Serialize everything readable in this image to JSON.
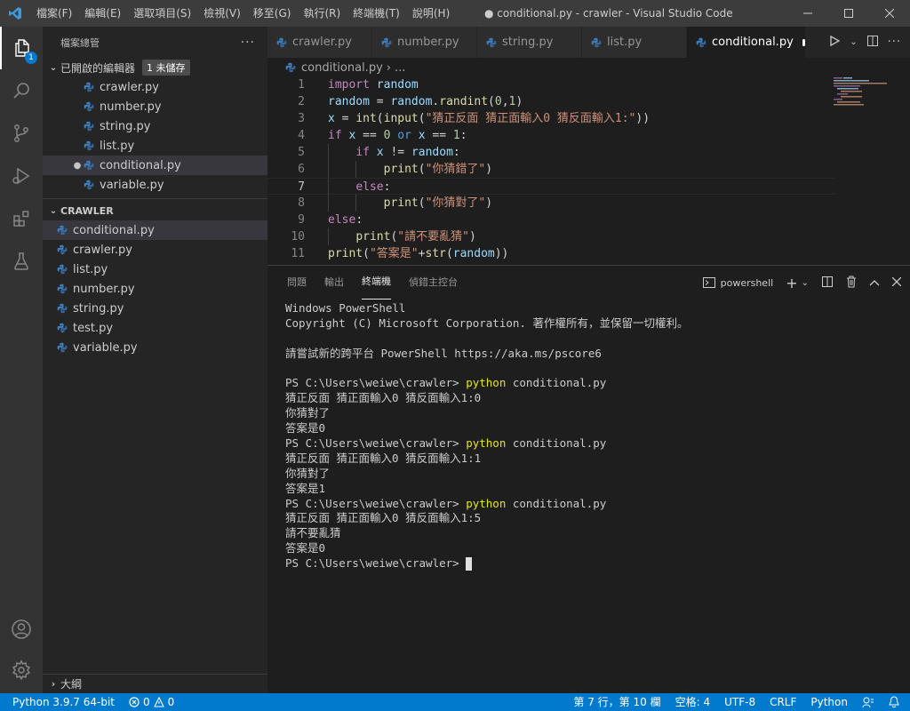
{
  "window": {
    "menu": [
      "檔案(F)",
      "編輯(E)",
      "選取項目(S)",
      "檢視(V)",
      "移至(G)",
      "執行(R)",
      "終端機(T)",
      "說明(H)"
    ],
    "title": "● conditional.py - crawler - Visual Studio Code"
  },
  "activitybar": {
    "explorer_badge": "1"
  },
  "sidebar": {
    "header": "檔案總管",
    "open_editors": {
      "title": "已開啟的編輯器",
      "unsaved_badge": "1 未儲存",
      "files": [
        "crawler.py",
        "number.py",
        "string.py",
        "list.py",
        "conditional.py",
        "variable.py"
      ]
    },
    "folder": {
      "title": "CRAWLER",
      "files": [
        "conditional.py",
        "crawler.py",
        "list.py",
        "number.py",
        "string.py",
        "test.py",
        "variable.py"
      ]
    },
    "outline": "大綱"
  },
  "tabs": [
    "crawler.py",
    "number.py",
    "string.py",
    "list.py",
    "conditional.py"
  ],
  "breadcrumb": {
    "file": "conditional.py",
    "rest": "..."
  },
  "editor": {
    "lines": [
      "1",
      "2",
      "3",
      "4",
      "5",
      "6",
      "7",
      "8",
      "9",
      "10",
      "11"
    ],
    "current_line": 7
  },
  "panel": {
    "tabs": [
      "問題",
      "輸出",
      "終端機",
      "偵錯主控台"
    ],
    "active_tab": "終端機",
    "shell": "powershell",
    "terminal": [
      "Windows PowerShell",
      "Copyright (C) Microsoft Corporation. 著作權所有，並保留一切權利。",
      "",
      "請嘗試新的跨平台 PowerShell https://aka.ms/pscore6",
      "",
      {
        "prompt": "PS C:\\Users\\weiwe\\crawler> ",
        "cmd": "python",
        "arg": " conditional.py"
      },
      "猜正反面 猜正面輸入0 猜反面輸入1:0",
      "你猜對了",
      "答案是0",
      {
        "prompt": "PS C:\\Users\\weiwe\\crawler> ",
        "cmd": "python",
        "arg": " conditional.py"
      },
      "猜正反面 猜正面輸入0 猜反面輸入1:1",
      "你猜對了",
      "答案是1",
      {
        "prompt": "PS C:\\Users\\weiwe\\crawler> ",
        "cmd": "python",
        "arg": " conditional.py"
      },
      "猜正反面 猜正面輸入0 猜反面輸入1:5",
      "請不要亂猜",
      "答案是0",
      {
        "prompt": "PS C:\\Users\\weiwe\\crawler> ",
        "cmd": "",
        "arg": "",
        "cursor": true
      }
    ]
  },
  "statusbar": {
    "interpreter": "Python 3.9.7 64-bit",
    "errors": "0",
    "warnings": "0",
    "position": "第 7 行，第 10 欄",
    "indent": "空格: 4",
    "encoding": "UTF-8",
    "eol": "CRLF",
    "language": "Python"
  }
}
